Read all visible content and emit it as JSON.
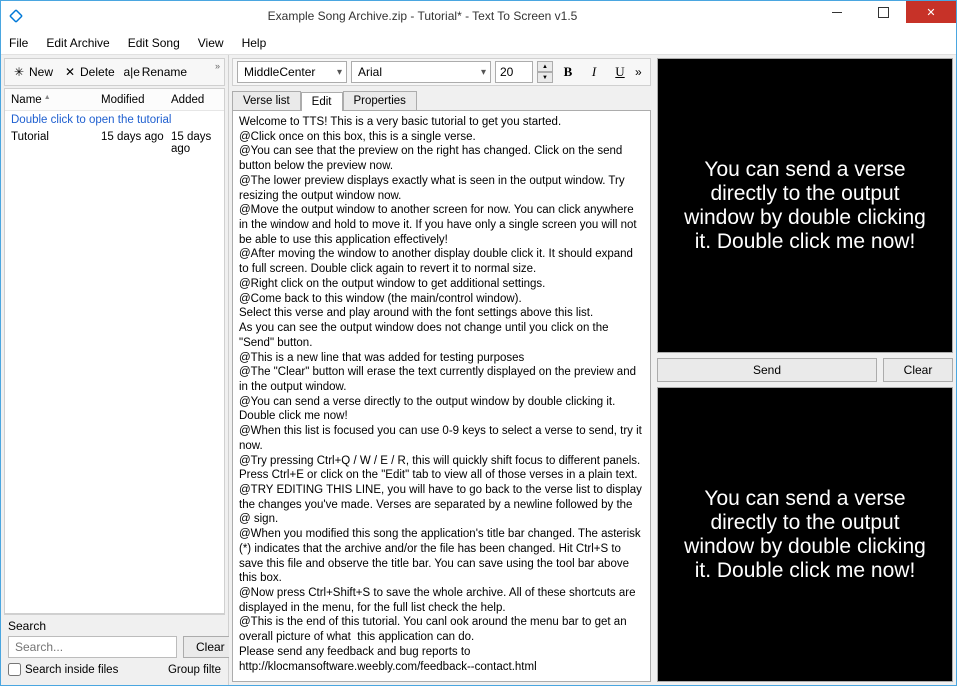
{
  "window": {
    "title": "Example Song Archive.zip - Tutorial* - Text To Screen v1.5"
  },
  "menu": {
    "file": "File",
    "edit_archive": "Edit Archive",
    "edit_song": "Edit Song",
    "view": "View",
    "help": "Help"
  },
  "left": {
    "toolbar": {
      "new": "New",
      "delete": "Delete",
      "rename": "Rename"
    },
    "columns": {
      "name": "Name",
      "modified": "Modified",
      "added": "Added"
    },
    "hint": "Double click to open the tutorial",
    "rows": [
      {
        "name": "Tutorial",
        "modified": "15 days ago",
        "added": "15 days ago"
      }
    ],
    "search": {
      "label": "Search",
      "placeholder": "Search...",
      "clear": "Clear",
      "inside": "Search inside files",
      "group": "Group filte"
    }
  },
  "center": {
    "fontbar": {
      "alignment": "MiddleCenter",
      "font": "Arial",
      "size": "20"
    },
    "tabs": {
      "verse_list": "Verse list",
      "edit": "Edit",
      "properties": "Properties"
    },
    "editor_text": "Welcome to TTS! This is a very basic tutorial to get you started.\n@Click once on this box, this is a single verse.\n@You can see that the preview on the right has changed. Click on the send button below the preview now.\n@The lower preview displays exactly what is seen in the output window. Try resizing the output window now.\n@Move the output window to another screen for now. You can click anywhere in the window and hold to move it. If you have only a single screen you will not be able to use this application effectively!\n@After moving the window to another display double click it. It should expand to full screen. Double click again to revert it to normal size.\n@Right click on the output window to get additional settings.\n@Come back to this window (the main/control window).\nSelect this verse and play around with the font settings above this list.\nAs you can see the output window does not change until you click on the \"Send\" button.\n@This is a new line that was added for testing purposes\n@The \"Clear\" button will erase the text currently displayed on the preview and in the output window.\n@You can send a verse directly to the output window by double clicking it. Double click me now!\n@When this list is focused you can use 0-9 keys to select a verse to send, try it now.\n@Try pressing Ctrl+Q / W / E / R, this will quickly shift focus to different panels. Press Ctrl+E or click on the \"Edit\" tab to view all of those verses in a plain text.\n@TRY EDITING THIS LINE, you will have to go back to the verse list to display the changes you've made. Verses are separated by a newline followed by the @ sign.\n@When you modified this song the application's title bar changed. The asterisk (*) indicates that the archive and/or the file has been changed. Hit Ctrl+S to save this file and observe the title bar. You can save using the tool bar above this box.\n@Now press Ctrl+Shift+S to save the whole archive. All of these shortcuts are displayed in the menu, for the full list check the help.\n@This is the end of this tutorial. You canl ook around the menu bar to get an overall picture of what  this application can do.\nPlease send any feedback and bug reports to http://klocmansoftware.weebly.com/feedback--contact.html"
  },
  "right": {
    "preview_text": "You can send a verse directly to the output window by double clicking it. Double click me now!",
    "send": "Send",
    "clear": "Clear"
  }
}
